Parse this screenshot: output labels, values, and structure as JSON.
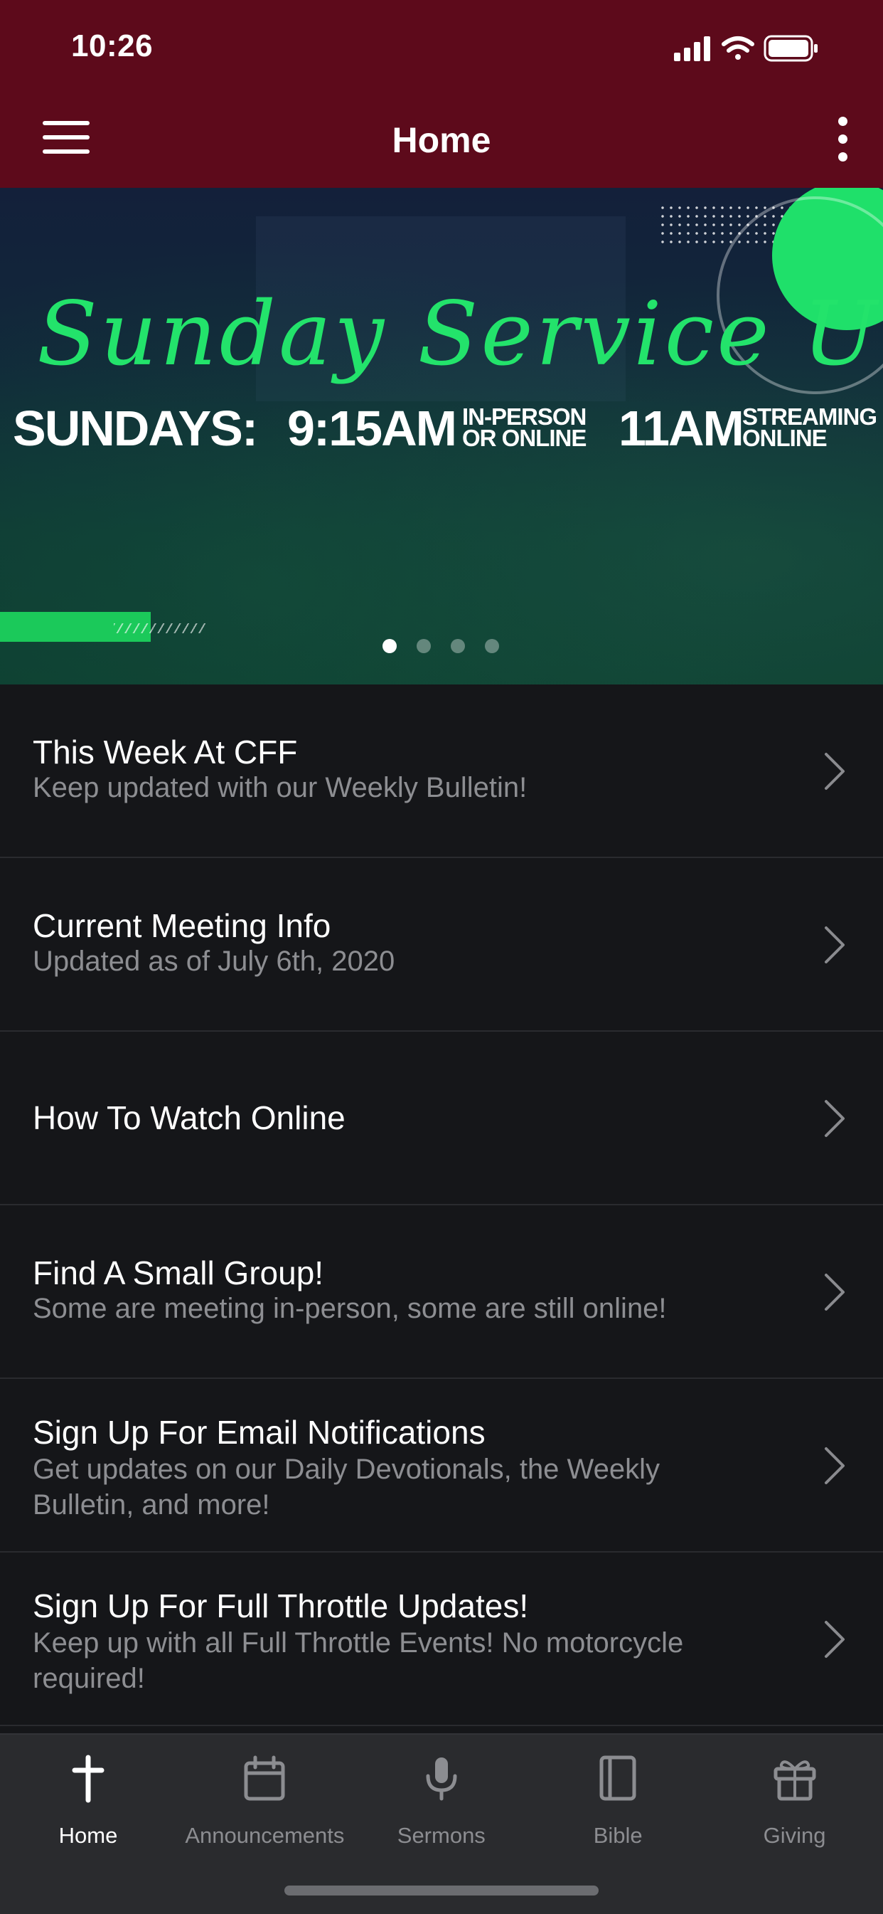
{
  "status_bar": {
    "time": "10:26"
  },
  "nav": {
    "title": "Home"
  },
  "banner": {
    "script_title": "Sunday Service Update",
    "schedule_prefix": "SUNDAYS:",
    "time1": "9:15AM",
    "time1_note_line1": "IN-PERSON",
    "time1_note_line2": "OR ONLINE",
    "time2": "11AM",
    "time2_note_line1": "STREAMING",
    "time2_note_line2": "ONLINE",
    "pager": {
      "count": 4,
      "active_index": 0
    },
    "colors": {
      "accent_green": "#23e36b"
    }
  },
  "list": [
    {
      "title": "This Week At CFF",
      "subtitle": "Keep updated with our Weekly Bulletin!"
    },
    {
      "title": "Current Meeting Info",
      "subtitle": "Updated as of July 6th, 2020"
    },
    {
      "title": "How To Watch Online",
      "subtitle": ""
    },
    {
      "title": "Find A Small Group!",
      "subtitle": "Some are meeting in-person, some are still online!"
    },
    {
      "title": "Sign Up For Email Notifications",
      "subtitle": "Get updates on our Daily Devotionals, the Weekly Bulletin, and more!"
    },
    {
      "title": "Sign Up For Full Throttle Updates!",
      "subtitle": "Keep up with all Full Throttle Events! No motorcycle required!"
    }
  ],
  "tabs": [
    {
      "label": "Home",
      "icon": "cross-icon",
      "active": true
    },
    {
      "label": "Announcements",
      "icon": "calendar-icon",
      "active": false
    },
    {
      "label": "Sermons",
      "icon": "microphone-icon",
      "active": false
    },
    {
      "label": "Bible",
      "icon": "book-icon",
      "active": false
    },
    {
      "label": "Giving",
      "icon": "gift-icon",
      "active": false
    }
  ],
  "colors": {
    "header_bg": "#5d0a1b",
    "list_bg": "#151619",
    "tabbar_bg": "#2a2b2e"
  }
}
